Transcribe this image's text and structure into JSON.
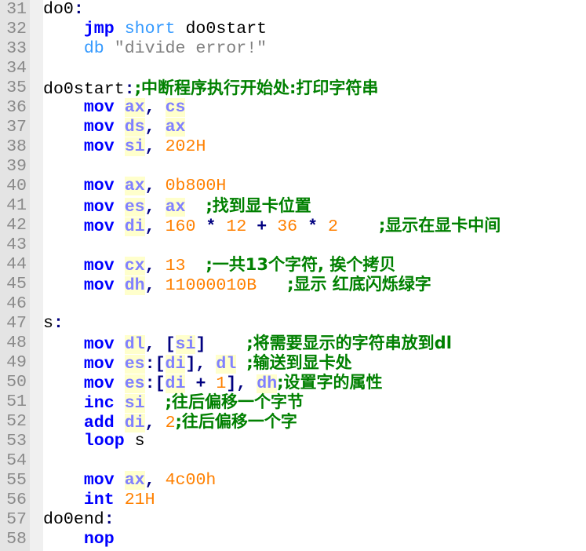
{
  "editor": {
    "language": "assembly",
    "colors": {
      "instruction": "#0000ff",
      "directive": "#3399ff",
      "register": "#8080ff",
      "register_highlight": "#ffffcc",
      "number": "#ff8000",
      "string": "#808080",
      "operator": "#000080",
      "comment": "#008000",
      "gutter": "#e4e4e4"
    },
    "lines": [
      {
        "n": "31",
        "tokens": [
          {
            "t": "lbl",
            "v": "do0"
          },
          {
            "t": "op",
            "v": ":"
          }
        ]
      },
      {
        "n": "32",
        "tokens": [
          {
            "t": "ws",
            "v": "    "
          },
          {
            "t": "kw",
            "v": "jmp"
          },
          {
            "t": "ws",
            "v": " "
          },
          {
            "t": "kw2",
            "v": "short"
          },
          {
            "t": "lbl",
            "v": " do0start"
          }
        ]
      },
      {
        "n": "33",
        "tokens": [
          {
            "t": "ws",
            "v": "    "
          },
          {
            "t": "kw2",
            "v": "db"
          },
          {
            "t": "ws",
            "v": " "
          },
          {
            "t": "str",
            "v": "\"divide error!\""
          }
        ]
      },
      {
        "n": "34",
        "tokens": []
      },
      {
        "n": "35",
        "tokens": [
          {
            "t": "lbl",
            "v": "do0start"
          },
          {
            "t": "op",
            "v": ":"
          },
          {
            "t": "cmt",
            "v": ";中断程序执行开始处:打印字符串"
          }
        ]
      },
      {
        "n": "36",
        "tokens": [
          {
            "t": "ws",
            "v": "    "
          },
          {
            "t": "kw",
            "v": "mov"
          },
          {
            "t": "ws",
            "v": " "
          },
          {
            "t": "reg",
            "v": "ax"
          },
          {
            "t": "op",
            "v": ","
          },
          {
            "t": "ws",
            "v": " "
          },
          {
            "t": "reg",
            "v": "cs"
          }
        ]
      },
      {
        "n": "37",
        "tokens": [
          {
            "t": "ws",
            "v": "    "
          },
          {
            "t": "kw",
            "v": "mov"
          },
          {
            "t": "ws",
            "v": " "
          },
          {
            "t": "reg",
            "v": "ds"
          },
          {
            "t": "op",
            "v": ","
          },
          {
            "t": "ws",
            "v": " "
          },
          {
            "t": "reg",
            "v": "ax"
          }
        ]
      },
      {
        "n": "38",
        "tokens": [
          {
            "t": "ws",
            "v": "    "
          },
          {
            "t": "kw",
            "v": "mov"
          },
          {
            "t": "ws",
            "v": " "
          },
          {
            "t": "reg",
            "v": "si"
          },
          {
            "t": "op",
            "v": ","
          },
          {
            "t": "ws",
            "v": " "
          },
          {
            "t": "num",
            "v": "202H"
          }
        ]
      },
      {
        "n": "39",
        "tokens": []
      },
      {
        "n": "40",
        "tokens": [
          {
            "t": "ws",
            "v": "    "
          },
          {
            "t": "kw",
            "v": "mov"
          },
          {
            "t": "ws",
            "v": " "
          },
          {
            "t": "reg",
            "v": "ax"
          },
          {
            "t": "op",
            "v": ","
          },
          {
            "t": "ws",
            "v": " "
          },
          {
            "t": "num",
            "v": "0b800H"
          }
        ]
      },
      {
        "n": "41",
        "tokens": [
          {
            "t": "ws",
            "v": "    "
          },
          {
            "t": "kw",
            "v": "mov"
          },
          {
            "t": "ws",
            "v": " "
          },
          {
            "t": "reg",
            "v": "es"
          },
          {
            "t": "op",
            "v": ","
          },
          {
            "t": "ws",
            "v": " "
          },
          {
            "t": "reg",
            "v": "ax"
          },
          {
            "t": "ws",
            "v": "  "
          },
          {
            "t": "cmt",
            "v": ";找到显卡位置"
          }
        ]
      },
      {
        "n": "42",
        "tokens": [
          {
            "t": "ws",
            "v": "    "
          },
          {
            "t": "kw",
            "v": "mov"
          },
          {
            "t": "ws",
            "v": " "
          },
          {
            "t": "reg",
            "v": "di"
          },
          {
            "t": "op",
            "v": ","
          },
          {
            "t": "ws",
            "v": " "
          },
          {
            "t": "num",
            "v": "160"
          },
          {
            "t": "ws",
            "v": " "
          },
          {
            "t": "op",
            "v": "*"
          },
          {
            "t": "ws",
            "v": " "
          },
          {
            "t": "num",
            "v": "12"
          },
          {
            "t": "ws",
            "v": " "
          },
          {
            "t": "op",
            "v": "+"
          },
          {
            "t": "ws",
            "v": " "
          },
          {
            "t": "num",
            "v": "36"
          },
          {
            "t": "ws",
            "v": " "
          },
          {
            "t": "op",
            "v": "*"
          },
          {
            "t": "ws",
            "v": " "
          },
          {
            "t": "num",
            "v": "2"
          },
          {
            "t": "ws",
            "v": "    "
          },
          {
            "t": "cmt",
            "v": ";显示在显卡中间"
          }
        ]
      },
      {
        "n": "43",
        "tokens": []
      },
      {
        "n": "44",
        "tokens": [
          {
            "t": "ws",
            "v": "    "
          },
          {
            "t": "kw",
            "v": "mov"
          },
          {
            "t": "ws",
            "v": " "
          },
          {
            "t": "reg",
            "v": "cx"
          },
          {
            "t": "op",
            "v": ","
          },
          {
            "t": "ws",
            "v": " "
          },
          {
            "t": "num",
            "v": "13"
          },
          {
            "t": "ws",
            "v": "  "
          },
          {
            "t": "cmt",
            "v": ";一共13个字符, 挨个拷贝"
          }
        ]
      },
      {
        "n": "45",
        "tokens": [
          {
            "t": "ws",
            "v": "    "
          },
          {
            "t": "kw",
            "v": "mov"
          },
          {
            "t": "ws",
            "v": " "
          },
          {
            "t": "reg",
            "v": "dh"
          },
          {
            "t": "op",
            "v": ","
          },
          {
            "t": "ws",
            "v": " "
          },
          {
            "t": "num",
            "v": "11000010B"
          },
          {
            "t": "ws",
            "v": "   "
          },
          {
            "t": "cmt",
            "v": ";显示 红底闪烁绿字"
          }
        ]
      },
      {
        "n": "46",
        "tokens": []
      },
      {
        "n": "47",
        "tokens": [
          {
            "t": "lbl",
            "v": "s"
          },
          {
            "t": "op",
            "v": ":"
          }
        ]
      },
      {
        "n": "48",
        "tokens": [
          {
            "t": "ws",
            "v": "    "
          },
          {
            "t": "kw",
            "v": "mov"
          },
          {
            "t": "ws",
            "v": " "
          },
          {
            "t": "reg",
            "v": "dl"
          },
          {
            "t": "op",
            "v": ","
          },
          {
            "t": "ws",
            "v": " "
          },
          {
            "t": "op",
            "v": "["
          },
          {
            "t": "reg",
            "v": "si"
          },
          {
            "t": "op",
            "v": "]"
          },
          {
            "t": "ws",
            "v": "    "
          },
          {
            "t": "cmt",
            "v": ";将需要显示的字符串放到dl"
          }
        ]
      },
      {
        "n": "49",
        "tokens": [
          {
            "t": "ws",
            "v": "    "
          },
          {
            "t": "kw",
            "v": "mov"
          },
          {
            "t": "ws",
            "v": " "
          },
          {
            "t": "reg",
            "v": "es"
          },
          {
            "t": "op",
            "v": ":["
          },
          {
            "t": "reg",
            "v": "di"
          },
          {
            "t": "op",
            "v": "],"
          },
          {
            "t": "ws",
            "v": " "
          },
          {
            "t": "reg",
            "v": "dl"
          },
          {
            "t": "ws",
            "v": " "
          },
          {
            "t": "cmt",
            "v": ";输送到显卡处"
          }
        ]
      },
      {
        "n": "50",
        "tokens": [
          {
            "t": "ws",
            "v": "    "
          },
          {
            "t": "kw",
            "v": "mov"
          },
          {
            "t": "ws",
            "v": " "
          },
          {
            "t": "reg",
            "v": "es"
          },
          {
            "t": "op",
            "v": ":["
          },
          {
            "t": "reg",
            "v": "di"
          },
          {
            "t": "ws",
            "v": " "
          },
          {
            "t": "op",
            "v": "+"
          },
          {
            "t": "ws",
            "v": " "
          },
          {
            "t": "num",
            "v": "1"
          },
          {
            "t": "op",
            "v": "],"
          },
          {
            "t": "ws",
            "v": " "
          },
          {
            "t": "reg",
            "v": "dh"
          },
          {
            "t": "cmt",
            "v": ";设置字的属性"
          }
        ]
      },
      {
        "n": "51",
        "tokens": [
          {
            "t": "ws",
            "v": "    "
          },
          {
            "t": "kw",
            "v": "inc"
          },
          {
            "t": "ws",
            "v": " "
          },
          {
            "t": "reg",
            "v": "si"
          },
          {
            "t": "ws",
            "v": "  "
          },
          {
            "t": "cmt",
            "v": ";往后偏移一个字节"
          }
        ]
      },
      {
        "n": "52",
        "tokens": [
          {
            "t": "ws",
            "v": "    "
          },
          {
            "t": "kw",
            "v": "add"
          },
          {
            "t": "ws",
            "v": " "
          },
          {
            "t": "reg",
            "v": "di"
          },
          {
            "t": "op",
            "v": ","
          },
          {
            "t": "ws",
            "v": " "
          },
          {
            "t": "num",
            "v": "2"
          },
          {
            "t": "cmt",
            "v": ";往后偏移一个字"
          }
        ]
      },
      {
        "n": "53",
        "tokens": [
          {
            "t": "ws",
            "v": "    "
          },
          {
            "t": "kw",
            "v": "loop"
          },
          {
            "t": "lbl",
            "v": " s"
          }
        ]
      },
      {
        "n": "54",
        "tokens": []
      },
      {
        "n": "55",
        "tokens": [
          {
            "t": "ws",
            "v": "    "
          },
          {
            "t": "kw",
            "v": "mov"
          },
          {
            "t": "ws",
            "v": " "
          },
          {
            "t": "reg",
            "v": "ax"
          },
          {
            "t": "op",
            "v": ","
          },
          {
            "t": "ws",
            "v": " "
          },
          {
            "t": "num",
            "v": "4c00h"
          }
        ]
      },
      {
        "n": "56",
        "tokens": [
          {
            "t": "ws",
            "v": "    "
          },
          {
            "t": "kw",
            "v": "int"
          },
          {
            "t": "ws",
            "v": " "
          },
          {
            "t": "num",
            "v": "21H"
          }
        ]
      },
      {
        "n": "57",
        "tokens": [
          {
            "t": "lbl",
            "v": "do0end"
          },
          {
            "t": "op",
            "v": ":"
          }
        ]
      },
      {
        "n": "58",
        "tokens": [
          {
            "t": "ws",
            "v": "    "
          },
          {
            "t": "kw",
            "v": "nop"
          }
        ]
      }
    ]
  }
}
